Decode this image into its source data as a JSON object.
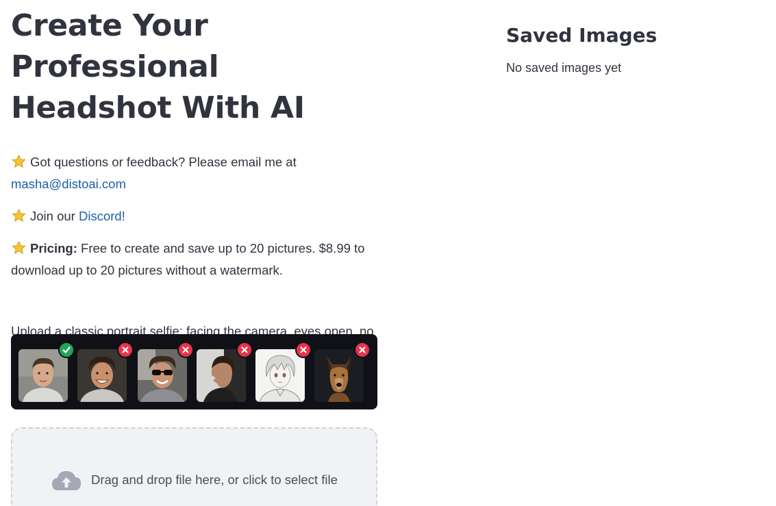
{
  "main": {
    "title": "Create Your Professional Headshot With AI",
    "contact": {
      "text": "Got questions or feedback? Please email me at",
      "email": "masha@distoai.com"
    },
    "discord": {
      "prefix": "Join our",
      "link": "Discord!"
    },
    "pricing": {
      "label": "Pricing:",
      "text": "Free to create and save up to 20 pictures. $8.99 to download up to 20 pictures without a watermark."
    },
    "instructions": "Upload a classic portrait selfie: facing the camera, eyes open, no smile, good lighting",
    "examples": [
      {
        "name": "front-facing-selfie",
        "status": "accepted"
      },
      {
        "name": "smiling-selfie",
        "status": "rejected"
      },
      {
        "name": "sunglasses-selfie",
        "status": "rejected"
      },
      {
        "name": "side-profile",
        "status": "rejected"
      },
      {
        "name": "anime-drawing",
        "status": "rejected"
      },
      {
        "name": "dog-photo",
        "status": "rejected"
      }
    ],
    "uploader": {
      "text": "Drag and drop file here, or click to select file",
      "icon": "cloud-upload-icon"
    }
  },
  "sidebar": {
    "title": "Saved Images",
    "empty_text": "No saved images yet"
  },
  "colors": {
    "link": "#1a5fa8",
    "accepted": "#22a55a",
    "rejected": "#e8334a",
    "examples_bg": "#0f1116"
  }
}
